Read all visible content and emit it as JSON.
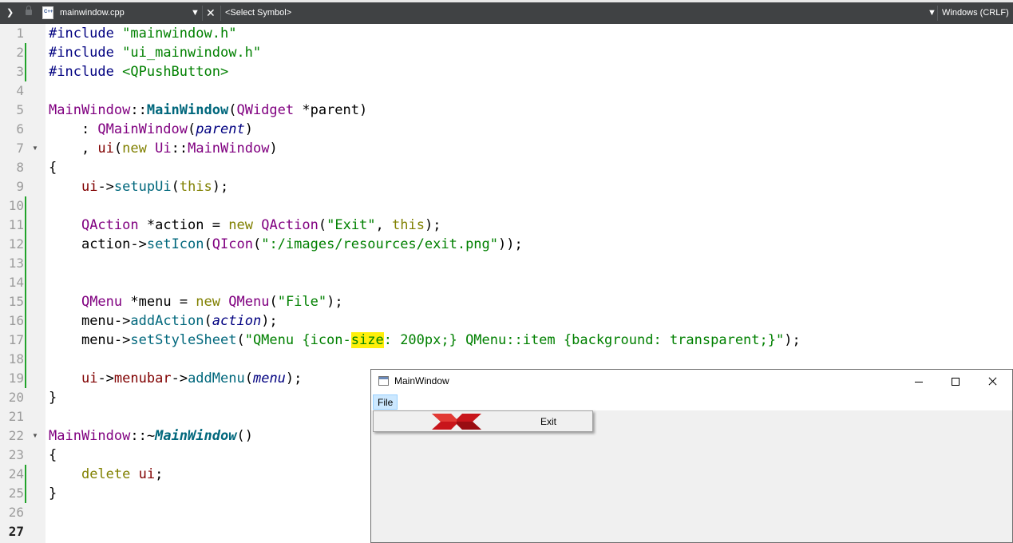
{
  "toolbar": {
    "file_name": "mainwindow.cpp",
    "file_icon_text": "C++",
    "symbol_selector": "<Select Symbol>",
    "line_endings": "Windows (CRLF)"
  },
  "editor": {
    "current_line": 27,
    "lines": [
      {
        "n": "1"
      },
      {
        "n": "2"
      },
      {
        "n": "3"
      },
      {
        "n": "4"
      },
      {
        "n": "5"
      },
      {
        "n": "6"
      },
      {
        "n": "7"
      },
      {
        "n": "8"
      },
      {
        "n": "9"
      },
      {
        "n": "10"
      },
      {
        "n": "11"
      },
      {
        "n": "12"
      },
      {
        "n": "13"
      },
      {
        "n": "14"
      },
      {
        "n": "15"
      },
      {
        "n": "16"
      },
      {
        "n": "17"
      },
      {
        "n": "18"
      },
      {
        "n": "19"
      },
      {
        "n": "20"
      },
      {
        "n": "21"
      },
      {
        "n": "22"
      },
      {
        "n": "23"
      },
      {
        "n": "24"
      },
      {
        "n": "25"
      },
      {
        "n": "26"
      },
      {
        "n": "27"
      }
    ],
    "tokens": {
      "inc": "#include",
      "h1": "\"mainwindow.h\"",
      "h2": "\"ui_mainwindow.h\"",
      "h3": "<QPushButton>",
      "mw": "MainWindow",
      "scope": "::",
      "tilde": "~",
      "qwidget": "QWidget",
      "star": " *",
      "parent": "parent",
      "qmainwindow": "QMainWindow",
      "ui": "ui",
      "kw_new": "new",
      "uins": "Ui",
      "setupUi": "setupUi",
      "kw_this": "this",
      "qaction": "QAction",
      "action": "action",
      "s_exit": "\"Exit\"",
      "setIcon": "setIcon",
      "qicon": "QIcon",
      "s_path": "\":/images/resources/exit.png\"",
      "qmenu": "QMenu",
      "menu": "menu",
      "s_file": "\"File\"",
      "addAction": "addAction",
      "setStyleSheet": "setStyleSheet",
      "s_css_a": "\"QMenu {icon-",
      "s_css_hl": "size",
      "s_css_b": ": 200px;} QMenu::item {background: transparent;}\"",
      "menubar": "menubar",
      "addMenu": "addMenu",
      "kw_delete": "delete",
      "arrow": "->"
    }
  },
  "app_window": {
    "title": "MainWindow",
    "menu_file": "File",
    "menu_item_exit": "Exit"
  },
  "colors": {
    "toolbar_bg": "#404244",
    "gutter_bg": "#f1f1f1",
    "change_bar": "#21a32a",
    "highlight": "#ffef0b",
    "menu_hover": "#cce8ff",
    "exit_icon_red": "#c8151b"
  }
}
